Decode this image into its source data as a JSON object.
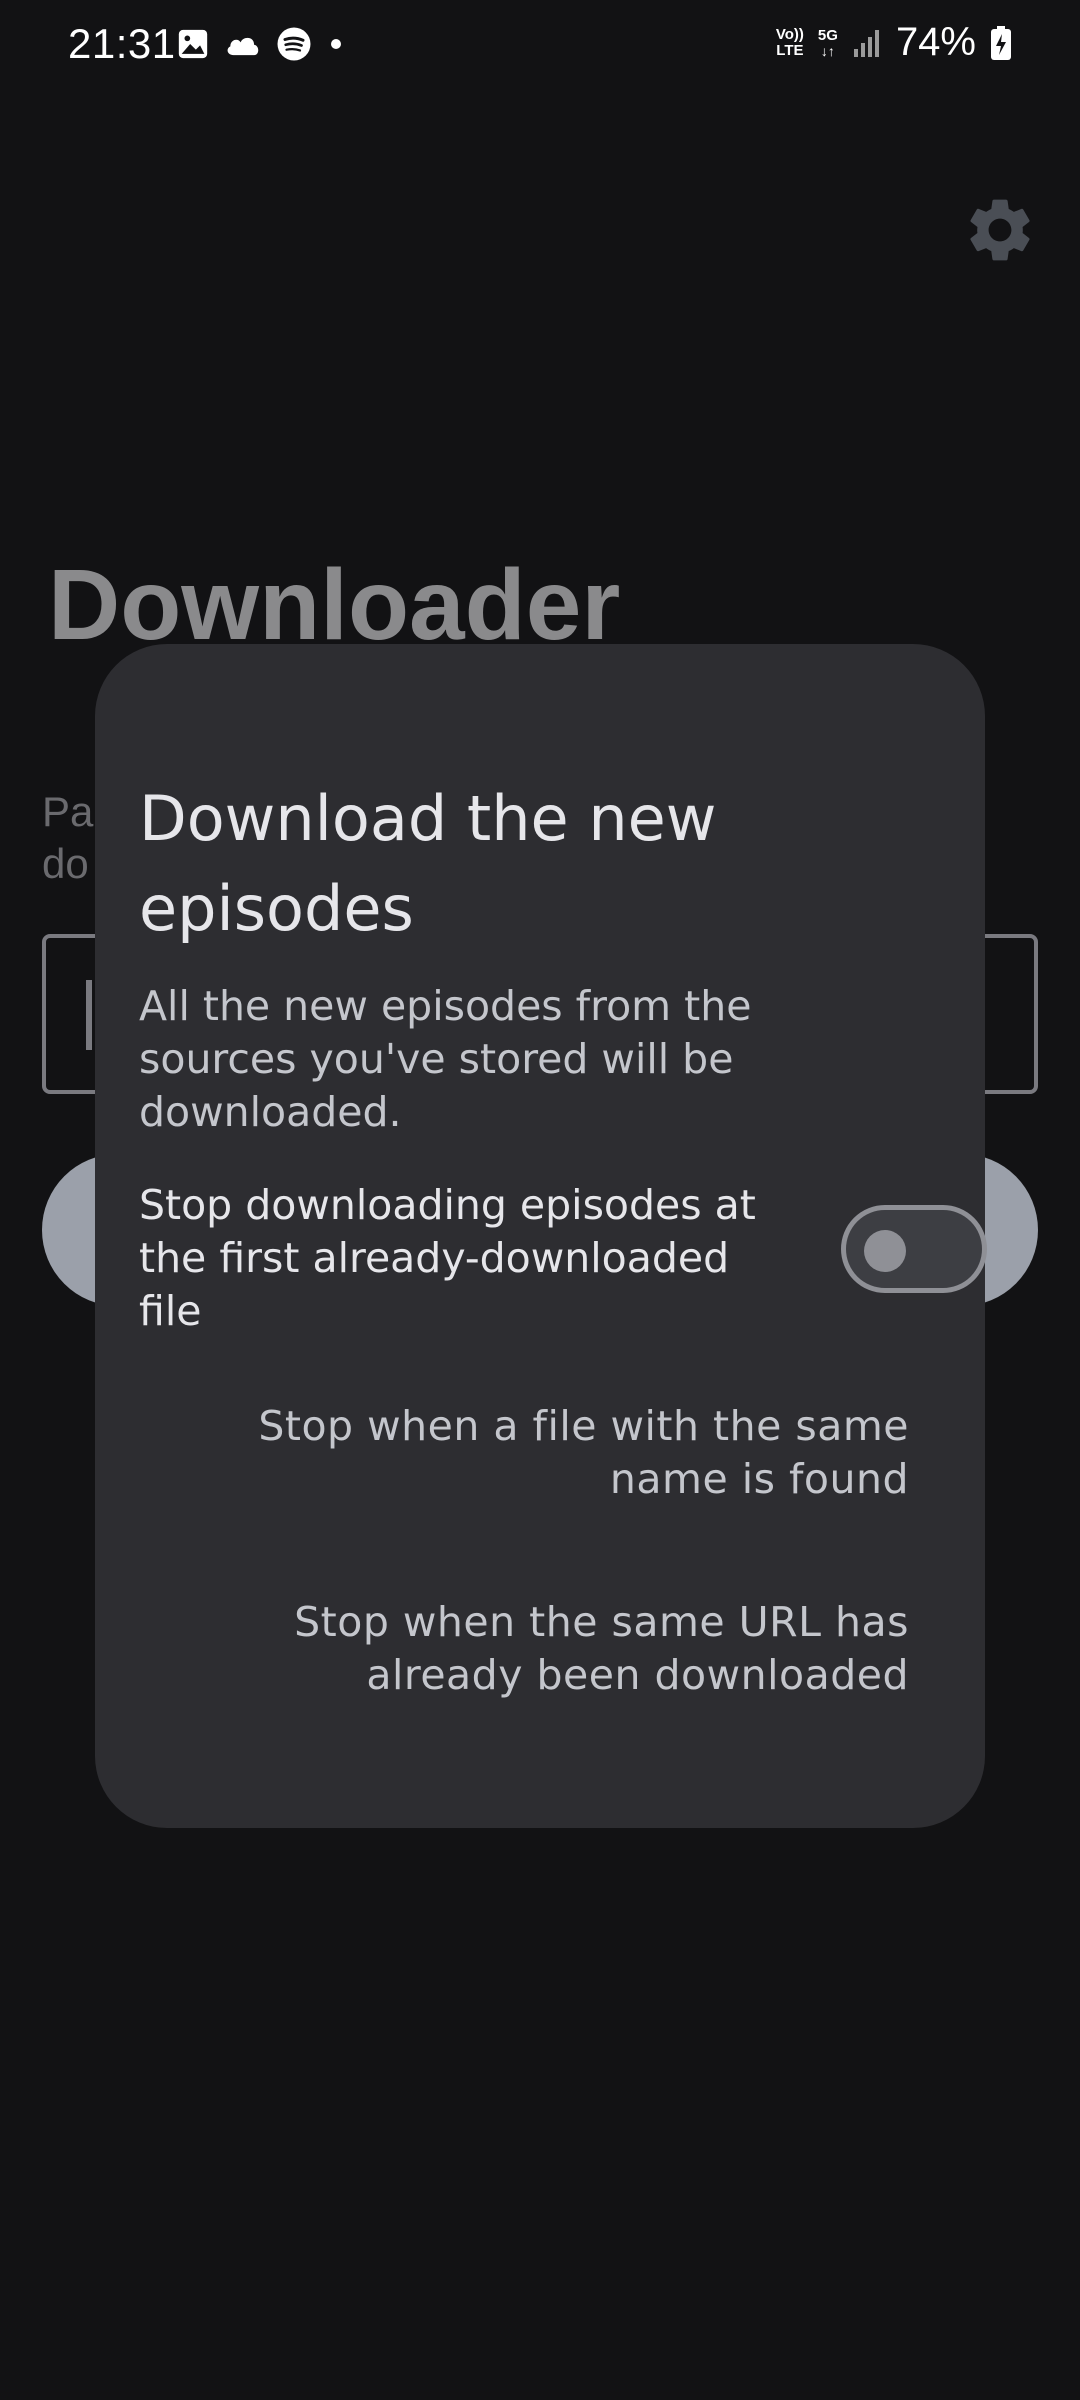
{
  "status_bar": {
    "time": "21:31",
    "network_badge_top": "Vo))",
    "network_badge_bottom": "LTE",
    "network_type": "5G",
    "battery": "74%",
    "icons": [
      "image-icon",
      "cloud-icon",
      "spotify-icon",
      "dot-icon",
      "signal-icon",
      "battery-charging-icon"
    ]
  },
  "app": {
    "title": "Downloader",
    "hint_fragment_line1": "Pa",
    "hint_fragment_line2": "do",
    "settings_icon": "gear-icon"
  },
  "dialog": {
    "title": "Download the new episodes",
    "body": "All the new episodes from the sources you've stored will be downloaded.",
    "toggle_label": "Stop downloading episodes at the first already-downloaded file",
    "toggle_on": false,
    "option_same_name": "Stop when a file with the same name is found",
    "option_same_url": "Stop when the same URL has already been downloaded"
  },
  "colors": {
    "background": "#121214",
    "dialog_surface": "#2d2d31",
    "title_text": "#e6e6ea",
    "body_text": "#c4c6cc",
    "button_bg": "#9ba0aa"
  }
}
